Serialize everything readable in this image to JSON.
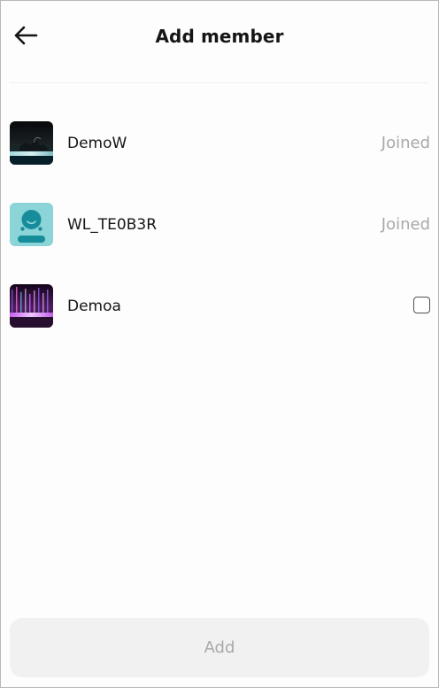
{
  "header": {
    "title": "Add member",
    "back_icon": "arrow-left-icon"
  },
  "members": [
    {
      "name": "DemoW",
      "status": "Joined",
      "avatar": "dark-landscape-photo"
    },
    {
      "name": "WL_TE0B3R",
      "status": "Joined",
      "avatar": "default-user-icon"
    },
    {
      "name": "Demoa",
      "status": "",
      "selected": false,
      "avatar": "purple-light-photo"
    }
  ],
  "footer": {
    "add_label": "Add"
  },
  "colors": {
    "status_text": "#a8a8a8",
    "avatar_teal": "#8bd4d7",
    "button_bg": "#f1f1f1",
    "button_text": "#a9a9a9"
  }
}
